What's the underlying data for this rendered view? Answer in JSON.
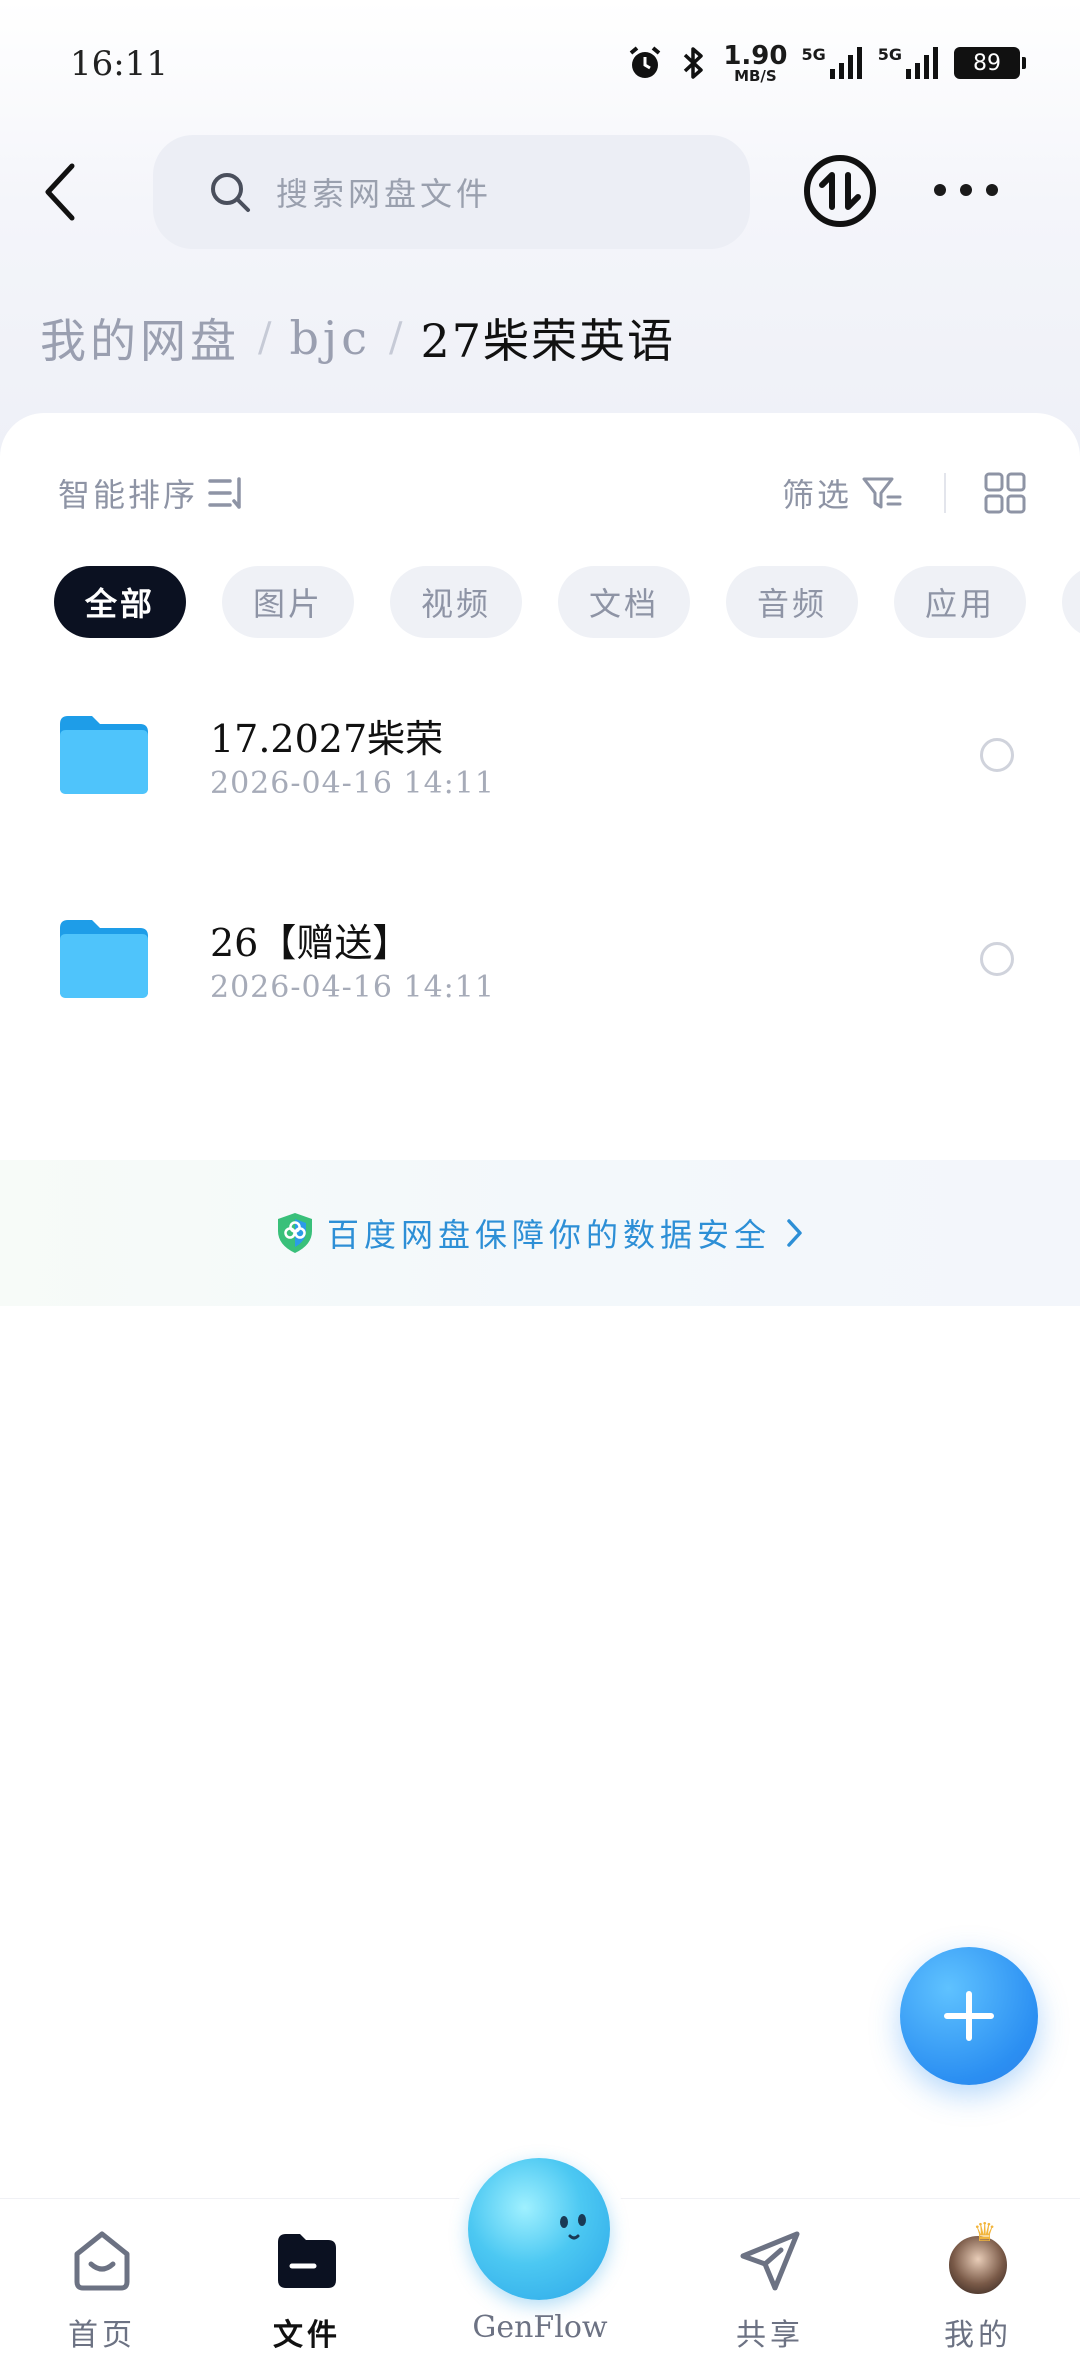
{
  "status_bar": {
    "time": "16:11",
    "net_speed_value": "1.90",
    "net_speed_unit": "MB/S",
    "signal1_label": "5G",
    "signal2_label": "5G",
    "battery": "89"
  },
  "header": {
    "search_placeholder": "搜索网盘文件"
  },
  "breadcrumb": {
    "items": [
      "我的网盘",
      "bjc"
    ],
    "separator": "/",
    "current": "27柴荣英语"
  },
  "toolbar": {
    "sort_label": "智能排序",
    "filter_label": "筛选"
  },
  "chips": [
    {
      "label": "全部",
      "active": true
    },
    {
      "label": "图片",
      "active": false
    },
    {
      "label": "视频",
      "active": false
    },
    {
      "label": "文档",
      "active": false
    },
    {
      "label": "音频",
      "active": false
    },
    {
      "label": "应用",
      "active": false
    }
  ],
  "files": [
    {
      "name": "17.2027柴荣",
      "date": "2026-04-16  14:11",
      "icon": "folder-icon"
    },
    {
      "name": "26【赠送】",
      "date": "2026-04-16  14:11",
      "icon": "folder-icon"
    }
  ],
  "security_banner": {
    "text": "百度网盘保障你的数据安全"
  },
  "bottom_nav": {
    "items": [
      {
        "label": "首页",
        "icon": "home-icon",
        "active": false
      },
      {
        "label": "文件",
        "icon": "folder-icon",
        "active": true
      },
      {
        "label": "GenFlow",
        "icon": "genflow-icon",
        "active": false
      },
      {
        "label": "共享",
        "icon": "send-icon",
        "active": false
      },
      {
        "label": "我的",
        "icon": "avatar-icon",
        "active": false
      }
    ]
  },
  "colors": {
    "accent": "#2b8ff2",
    "active_chip": "#0b1121",
    "folder": "#3cb4f5",
    "banner_text": "#2d8fd6"
  }
}
